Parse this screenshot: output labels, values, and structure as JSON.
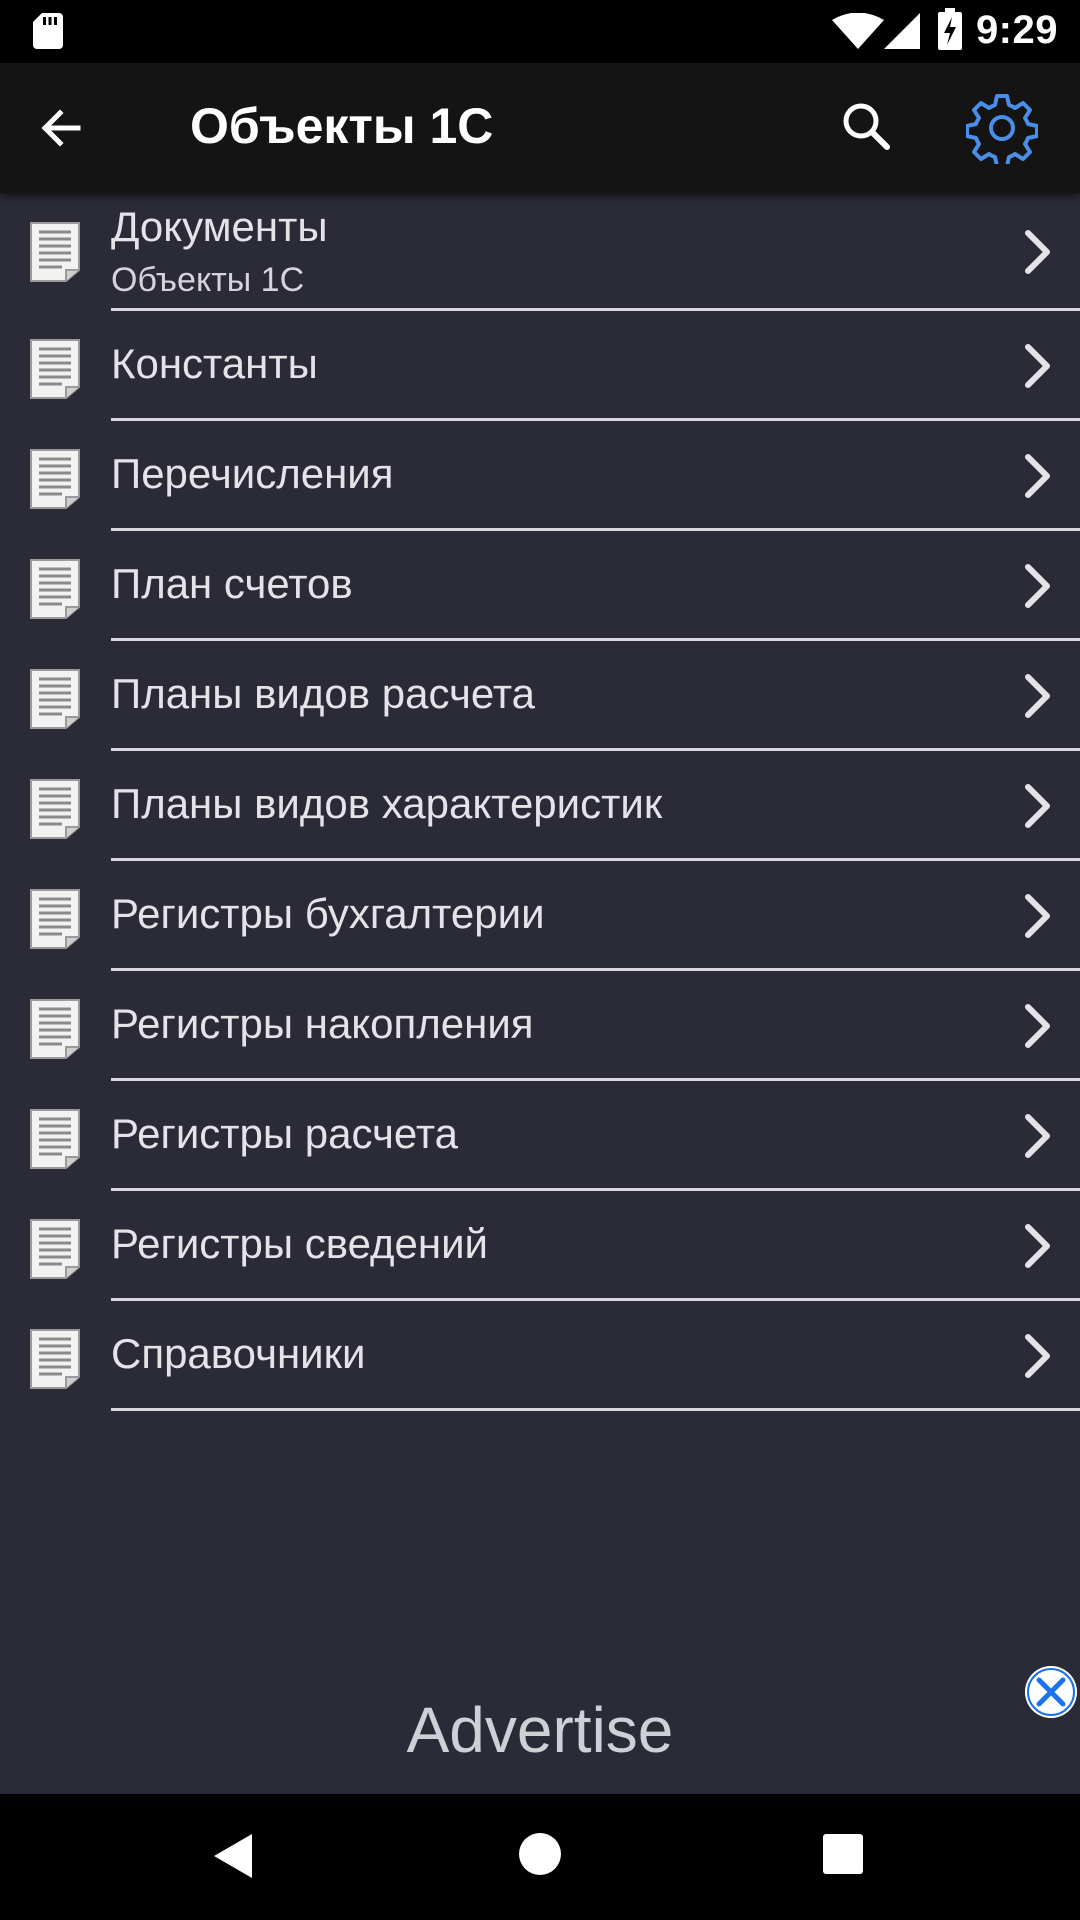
{
  "status_bar": {
    "time": "9:29",
    "icons": [
      "sd-card-icon",
      "wifi-icon",
      "cell-signal-icon",
      "battery-charging-icon"
    ]
  },
  "app_bar": {
    "back_icon": "arrow-back-icon",
    "title": "Объекты 1С",
    "search_icon": "search-icon",
    "settings_icon": "gear-icon"
  },
  "colors": {
    "background": "#2a2b37",
    "app_bar": "#141414",
    "accent": "#4a8fe7",
    "text": "#e4e4e8",
    "divider": "#d8d8de"
  },
  "list": {
    "items": [
      {
        "label": "Документы",
        "sublabel": "Объекты 1С"
      },
      {
        "label": "Константы"
      },
      {
        "label": "Перечисления"
      },
      {
        "label": "План счетов"
      },
      {
        "label": "Планы видов расчета"
      },
      {
        "label": "Планы видов характеристик"
      },
      {
        "label": "Регистры бухгалтерии"
      },
      {
        "label": "Регистры накопления"
      },
      {
        "label": "Регистры расчета"
      },
      {
        "label": "Регистры сведений"
      },
      {
        "label": "Справочники"
      }
    ],
    "item_icon": "document-list-icon",
    "chevron_icon": "chevron-right-icon"
  },
  "ad": {
    "label": "Advertise",
    "close_icon": "close-icon"
  },
  "nav_bar": {
    "icons": [
      "back-triangle-icon",
      "home-circle-icon",
      "recents-square-icon"
    ]
  }
}
